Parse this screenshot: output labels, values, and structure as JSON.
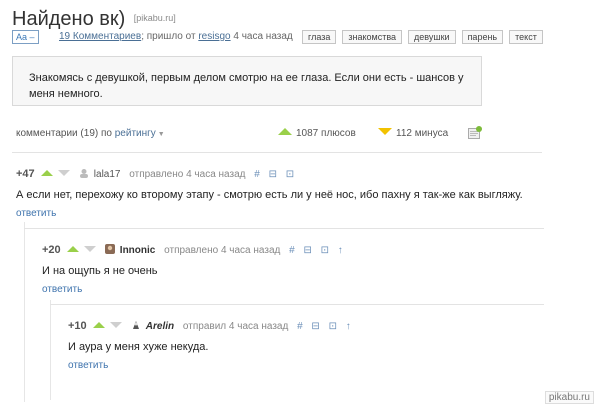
{
  "post": {
    "title": "Найдено вк)",
    "source": "[pikabu.ru]",
    "font_button": "Aa –",
    "comments_link": "19 Комментариев",
    "came_from": "; пришло от",
    "author": "resisgo",
    "time": "4 часа назад",
    "tags": [
      "глаза",
      "знакомства",
      "девушки",
      "парень",
      "текст"
    ],
    "story": "Знакомясь с девушкой, первым делом смотрю на ее глаза. Если они есть - шансов у меня немного."
  },
  "stats": {
    "comments_label": "комментарии (19) по",
    "sort_label": "рейтингу",
    "plus_text": "1087 плюсов",
    "minus_text": "112 минуса"
  },
  "comments": [
    {
      "score": "+47",
      "author": "lala17",
      "action": "отправлено 4 часа назад",
      "icons": "# ⊟ ⊡",
      "body": "А если нет, перехожу ко второму этапу - смотрю есть ли у неё нос, ибо пахну я так-же как выгляжу.",
      "reply": "ответить"
    },
    {
      "score": "+20",
      "author": "Innonic",
      "action": "отправлено 4 часа назад",
      "icons": "# ⊟ ⊡ ↑",
      "body": "И на ощупь я не очень",
      "reply": "ответить"
    },
    {
      "score": "+10",
      "author": "Arelin",
      "action": "отправил 4 часа назад",
      "icons": "# ⊟ ⊡ ↑",
      "body": "И аура у меня хуже некуда.",
      "reply": "ответить"
    }
  ],
  "watermark": "pikabu.ru",
  "colors": {
    "accent": "#9ad04a",
    "minus": "#f2c200",
    "link": "#3e73ad"
  }
}
